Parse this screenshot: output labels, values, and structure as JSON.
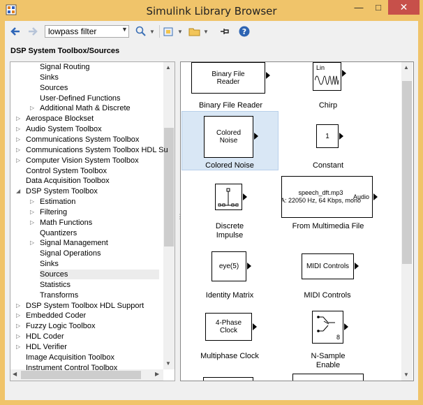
{
  "window": {
    "title": "Simulink Library Browser"
  },
  "toolbar": {
    "search_value": "lowpass filter"
  },
  "breadcrumb": "DSP System Toolbox/Sources",
  "tree": [
    {
      "label": "Signal Routing",
      "depth": 2,
      "expand": false
    },
    {
      "label": "Sinks",
      "depth": 2,
      "expand": false
    },
    {
      "label": "Sources",
      "depth": 2,
      "expand": false
    },
    {
      "label": "User-Defined Functions",
      "depth": 2,
      "expand": false
    },
    {
      "label": "Additional Math & Discrete",
      "depth": 2,
      "expand": true
    },
    {
      "label": "Aerospace Blockset",
      "depth": 1,
      "expand": true
    },
    {
      "label": "Audio System Toolbox",
      "depth": 1,
      "expand": true
    },
    {
      "label": "Communications System Toolbox",
      "depth": 1,
      "expand": true
    },
    {
      "label": "Communications System Toolbox HDL Su",
      "depth": 1,
      "expand": true
    },
    {
      "label": "Computer Vision System Toolbox",
      "depth": 1,
      "expand": true
    },
    {
      "label": "Control System Toolbox",
      "depth": 1,
      "expand": false
    },
    {
      "label": "Data Acquisition Toolbox",
      "depth": 1,
      "expand": false
    },
    {
      "label": "DSP System Toolbox",
      "depth": 1,
      "expand": "open"
    },
    {
      "label": "Estimation",
      "depth": 2,
      "expand": true
    },
    {
      "label": "Filtering",
      "depth": 2,
      "expand": true
    },
    {
      "label": "Math Functions",
      "depth": 2,
      "expand": true
    },
    {
      "label": "Quantizers",
      "depth": 2,
      "expand": false
    },
    {
      "label": "Signal Management",
      "depth": 2,
      "expand": true
    },
    {
      "label": "Signal Operations",
      "depth": 2,
      "expand": false
    },
    {
      "label": "Sinks",
      "depth": 2,
      "expand": false
    },
    {
      "label": "Sources",
      "depth": 2,
      "expand": false,
      "selected": true
    },
    {
      "label": "Statistics",
      "depth": 2,
      "expand": false
    },
    {
      "label": "Transforms",
      "depth": 2,
      "expand": false
    },
    {
      "label": "DSP System Toolbox HDL Support",
      "depth": 1,
      "expand": true
    },
    {
      "label": "Embedded Coder",
      "depth": 1,
      "expand": true
    },
    {
      "label": "Fuzzy Logic Toolbox",
      "depth": 1,
      "expand": true
    },
    {
      "label": "HDL Coder",
      "depth": 1,
      "expand": true
    },
    {
      "label": "HDL Verifier",
      "depth": 1,
      "expand": true
    },
    {
      "label": "Image Acquisition Toolbox",
      "depth": 1,
      "expand": false
    },
    {
      "label": "Instrument Control Toolbox",
      "depth": 1,
      "expand": false
    }
  ],
  "blocks": {
    "binary_file_reader": {
      "face": "Binary File\nReader",
      "label": "Binary File Reader"
    },
    "chirp": {
      "face": "Lin",
      "label": "Chirp"
    },
    "colored_noise": {
      "face": "Colored\nNoise",
      "label": "Colored Noise"
    },
    "constant": {
      "face": "1",
      "label": "Constant"
    },
    "discrete_impulse": {
      "face": "",
      "label": "Discrete\nImpulse"
    },
    "from_multimedia_file": {
      "face": "speech_dft.mp3\nA: 22050 Hz, 64 Kbps, mono",
      "port": "Audio",
      "label": "From Multimedia File"
    },
    "identity_matrix": {
      "face": "eye(5)",
      "label": "Identity Matrix"
    },
    "midi_controls": {
      "face": "MIDI Controls",
      "label": "MIDI Controls"
    },
    "multiphase_clock": {
      "face": "4-Phase\nClock",
      "label": "Multiphase Clock"
    },
    "n_sample_enable": {
      "face": "8",
      "label": "N-Sample\nEnable"
    }
  }
}
